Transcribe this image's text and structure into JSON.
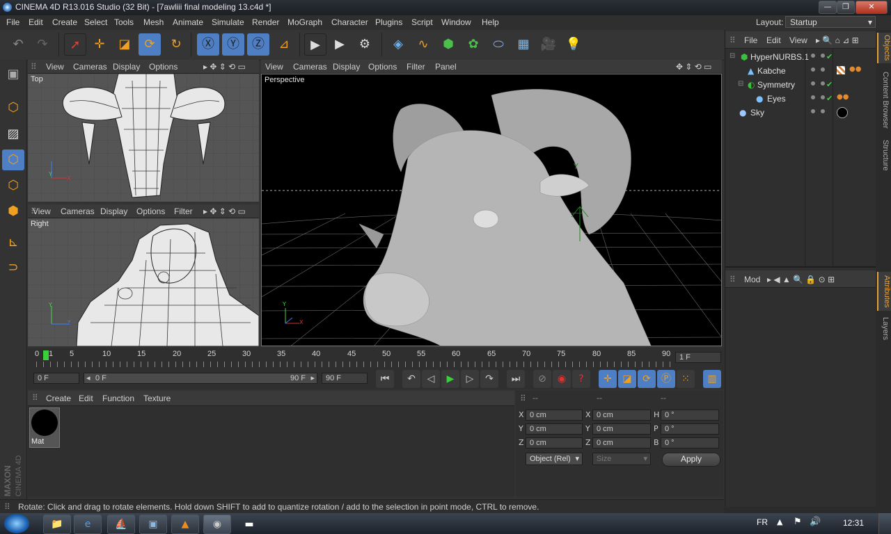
{
  "window": {
    "title": "CINEMA 4D R13.016 Studio (32 Bit) - [7awliii final modeling 13.c4d *]",
    "min_glyph": "—",
    "max_glyph": "❐",
    "close_glyph": "✕"
  },
  "menubar": {
    "items": [
      "File",
      "Edit",
      "Create",
      "Select",
      "Tools",
      "Mesh",
      "Animate",
      "Simulate",
      "Render",
      "Character",
      "Plugins",
      "Script",
      "Window",
      "Help"
    ],
    "mograph": "MoGraph",
    "layout_label": "Layout:",
    "layout_value": "Startup"
  },
  "viewport_top": {
    "menu": [
      "View",
      "Cameras",
      "Display",
      "Options"
    ],
    "label": "Top"
  },
  "viewport_right": {
    "menu": [
      "View",
      "Cameras",
      "Display",
      "Options",
      "Filter"
    ],
    "label": "Right"
  },
  "viewport_persp": {
    "menu": [
      "View",
      "Cameras",
      "Display",
      "Options",
      "Filter",
      "Panel"
    ],
    "label": "Perspective"
  },
  "axis": {
    "x": "X",
    "y": "Y",
    "z": "Z"
  },
  "object_manager": {
    "menu": [
      "File",
      "Edit",
      "View"
    ],
    "objects": [
      {
        "name": "HyperNURBS.1"
      },
      {
        "name": "Kabche"
      },
      {
        "name": "Symmetry"
      },
      {
        "name": "Eyes"
      },
      {
        "name": "Sky"
      }
    ],
    "check": "✔"
  },
  "attributes": {
    "mode_label": "Mod"
  },
  "side_tabs": {
    "objects": "Objects",
    "content_browser": "Content Browser",
    "structure": "Structure",
    "attributes": "Attributes",
    "layers": "Layers"
  },
  "timeline": {
    "ticks": [
      "0",
      "5",
      "10",
      "15",
      "20",
      "25",
      "30",
      "35",
      "40",
      "45",
      "50",
      "55",
      "60",
      "65",
      "70",
      "75",
      "80",
      "85",
      "90"
    ],
    "current_frame_marker": "1",
    "frame_field": "1 F"
  },
  "transport": {
    "start_field": "0 F",
    "range_start": "0 F",
    "range_end": "90 F",
    "end_field": "90 F"
  },
  "material_manager": {
    "menu": [
      "Create",
      "Edit",
      "Function",
      "Texture"
    ],
    "materials": [
      {
        "name": "Mat",
        "color": "#000000"
      }
    ]
  },
  "coordinates": {
    "headers": [
      "--",
      "--",
      "--"
    ],
    "rows": [
      {
        "a": "X",
        "av": "0 cm",
        "b": "X",
        "bv": "0 cm",
        "c": "H",
        "cv": "0 °"
      },
      {
        "a": "Y",
        "av": "0 cm",
        "b": "Y",
        "bv": "0 cm",
        "c": "P",
        "cv": "0 °"
      },
      {
        "a": "Z",
        "av": "0 cm",
        "b": "Z",
        "bv": "0 cm",
        "c": "B",
        "cv": "0 °"
      }
    ],
    "mode_select": "Object (Rel)",
    "size_select": "Size",
    "apply_label": "Apply"
  },
  "status": {
    "text": "Rotate: Click and drag to rotate elements. Hold down SHIFT to add to quantize rotation / add to the selection in point mode, CTRL to remove."
  },
  "logo": {
    "text1": "MAXON",
    "text2": "CINEMA 4D"
  },
  "taskbar": {
    "lang": "FR",
    "clock": "12:31"
  },
  "colors": {
    "accent": "#4e7fc4",
    "orange": "#f0a020",
    "active_tab": "#e8a23a",
    "check": "#3ad03a"
  }
}
